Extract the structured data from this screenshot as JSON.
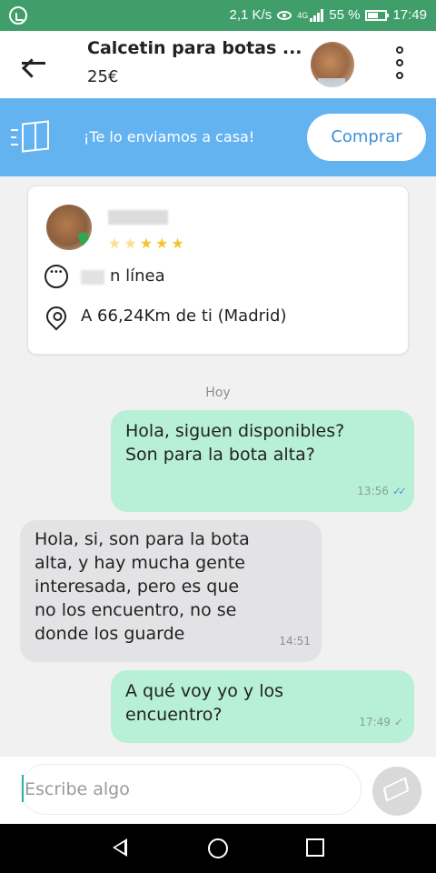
{
  "status_bar": {
    "net_speed": "2,1 K/s",
    "network_type": "4G",
    "battery": "55 %",
    "time": "17:49"
  },
  "header": {
    "title": "Calcetin para botas ...",
    "price": "25€"
  },
  "banner": {
    "text": "¡Te lo enviamos a casa!",
    "buy_label": "Comprar"
  },
  "seller": {
    "online_text": "n línea",
    "location": "A 66,24Km de ti (Madrid)"
  },
  "chat": {
    "day_label": "Hoy",
    "messages": [
      {
        "direction": "out",
        "text": "Hola, siguen disponibles?\nSon para la bota alta?",
        "time": "13:56",
        "status": "read"
      },
      {
        "direction": "in",
        "text": "Hola, si, son para la bota\nalta, y hay mucha gente\ninteresada, pero es que\nno los encuentro, no se\ndonde los guarde",
        "time": "14:51"
      },
      {
        "direction": "out",
        "text": "A qué voy yo y los\nencuentro?",
        "time": "17:49",
        "status": "sent"
      }
    ]
  },
  "composer": {
    "placeholder": "Escribe algo"
  },
  "colors": {
    "status_bar": "#3f9e6a",
    "banner": "#64b3f1",
    "outgoing_bubble": "#b7f0d6",
    "incoming_bubble": "#e3e3e5"
  }
}
